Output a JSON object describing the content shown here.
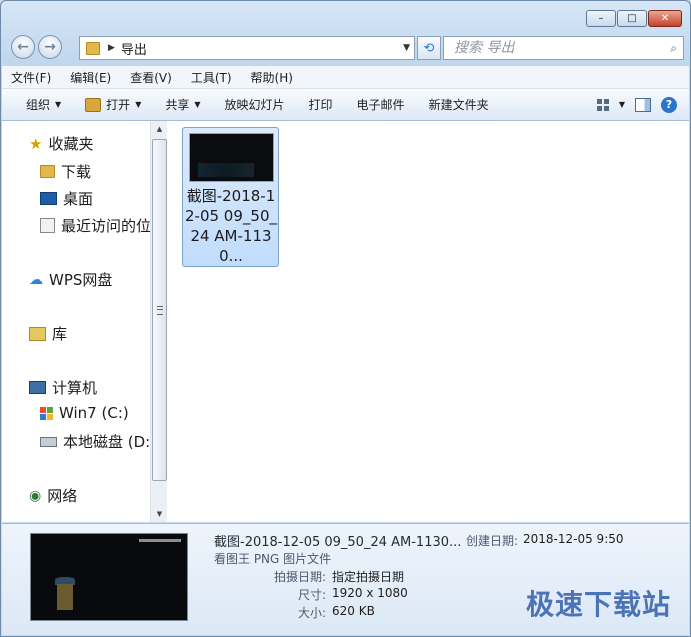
{
  "window": {
    "minimize_glyph": "–",
    "maximize_glyph": "□",
    "close_glyph": "✕"
  },
  "nav": {
    "back_glyph": "←",
    "forward_glyph": "→",
    "path_sep": "▶",
    "path": "导出",
    "dropdown_glyph": "▼",
    "refresh_glyph": "⟲"
  },
  "search": {
    "placeholder": "搜索 导出",
    "icon_glyph": "⌕"
  },
  "menu": [
    "文件(F)",
    "编辑(E)",
    "查看(V)",
    "工具(T)",
    "帮助(H)"
  ],
  "toolbar": {
    "organize": "组织",
    "open": "打开",
    "share": "共享",
    "slideshow": "放映幻灯片",
    "print": "打印",
    "email": "电子邮件",
    "new_folder": "新建文件夹",
    "arrow": "▼",
    "help_glyph": "?"
  },
  "sidebar": {
    "favorites": "收藏夹",
    "downloads": "下载",
    "desktop": "桌面",
    "recent": "最近访问的位",
    "wps": "WPS网盘",
    "library": "库",
    "computer": "计算机",
    "win7": "Win7 (C:)",
    "local_disk": "本地磁盘 (D:",
    "network": "网络",
    "star_glyph": "★",
    "cloud_glyph": "☁",
    "net_glyph": "◉"
  },
  "scrollbar": {
    "up_glyph": "▲",
    "down_glyph": "▼"
  },
  "file": {
    "name": "截图-2018-12-05 09_50_24 AM-1130..."
  },
  "details": {
    "filename": "截图-2018-12-05 09_50_24 AM-1130...",
    "type": "看图王 PNG 图片文件",
    "created_label": "创建日期:",
    "created_value": "2018-12-05 9:50",
    "shot_label": "拍摄日期:",
    "shot_value": "指定拍摄日期",
    "size_label": "尺寸:",
    "size_value": "1920 x 1080",
    "bytes_label": "大小:",
    "bytes_value": "620 KB"
  },
  "watermark": "极速下载站"
}
